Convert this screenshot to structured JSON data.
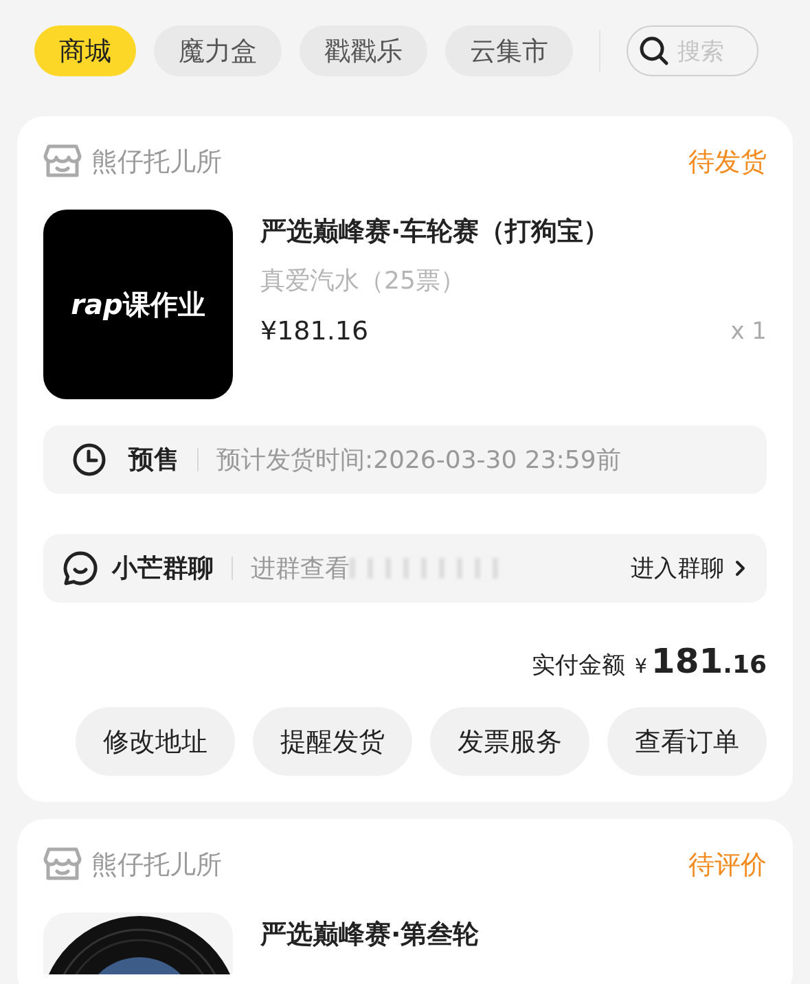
{
  "tabs": [
    {
      "label": "商城",
      "selected": true
    },
    {
      "label": "魔力盒",
      "selected": false
    },
    {
      "label": "戳戳乐",
      "selected": false
    },
    {
      "label": "云集市",
      "selected": false
    }
  ],
  "search": {
    "placeholder": "搜索"
  },
  "orders": [
    {
      "shop": "熊仔托儿所",
      "status": "待发货",
      "product": {
        "title": "严选巅峰赛·车轮赛（打狗宝）",
        "variant": "真爱汽水（25票）",
        "price": "¥181.16",
        "quantity": "x 1",
        "cover": {
          "kind": "text",
          "accent": "rap",
          "text": "课作业"
        }
      },
      "presale": {
        "label": "预售",
        "info": "预计发货时间:2026-03-30 23:59前"
      },
      "group_chat": {
        "name": "小芒群聊",
        "hint": "进群查看",
        "action": "进入群聊"
      },
      "total": {
        "label": "实付金额",
        "currency": "¥",
        "integer": "181",
        "decimal": ".16"
      },
      "buttons": [
        "修改地址",
        "提醒发货",
        "发票服务",
        "查看订单"
      ]
    },
    {
      "shop": "熊仔托儿所",
      "status": "待评价",
      "product": {
        "title": "严选巅峰赛·第叁轮"
      }
    }
  ]
}
